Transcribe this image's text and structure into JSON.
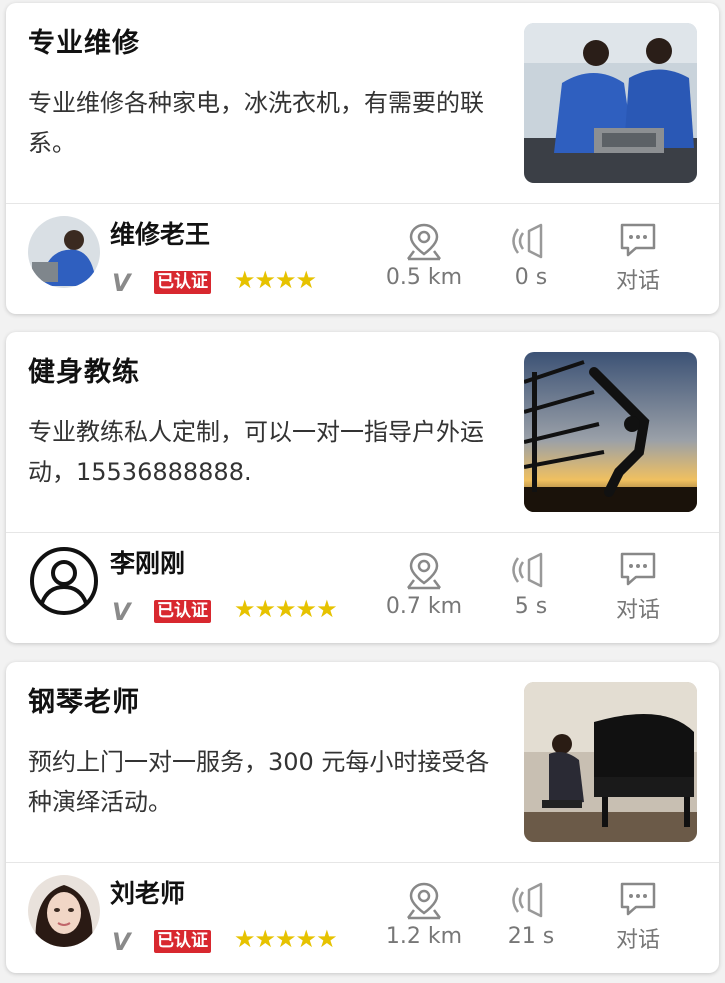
{
  "cards": [
    {
      "title": "专业维修",
      "description": "专业维修各种家电，冰洗衣机，有需要的联系。",
      "name": "维修老王",
      "v_mark": "V",
      "verified_label": "已认证",
      "rating": 4,
      "stars_text": "★★★★",
      "distance": "0.5 km",
      "duration": "0 s",
      "chat_label": "对话",
      "thumb": "repair-technicians-photo",
      "avatar": "repair-worker-photo"
    },
    {
      "title": "健身教练",
      "description": "专业教练私人定制，可以一对一指导户外运动，15536888888.",
      "name": "李刚刚",
      "v_mark": "V",
      "verified_label": "已认证",
      "rating": 5,
      "stars_text": "★★★★★",
      "distance": "0.7 km",
      "duration": "5 s",
      "chat_label": "对话",
      "thumb": "fitness-silhouette-sunset-photo",
      "avatar": "default-user-icon"
    },
    {
      "title": "钢琴老师",
      "description": "预约上门一对一服务，300 元每小时接受各种演绎活动。",
      "name": "刘老师",
      "v_mark": "V",
      "verified_label": "已认证",
      "rating": 5,
      "stars_text": "★★★★★",
      "distance": "1.2 km",
      "duration": "21 s",
      "chat_label": "对话",
      "thumb": "piano-player-photo",
      "avatar": "woman-portrait-photo"
    }
  ],
  "colors": {
    "verified_bg": "#d8282f",
    "star": "#e6c200",
    "muted_text": "#777777"
  }
}
